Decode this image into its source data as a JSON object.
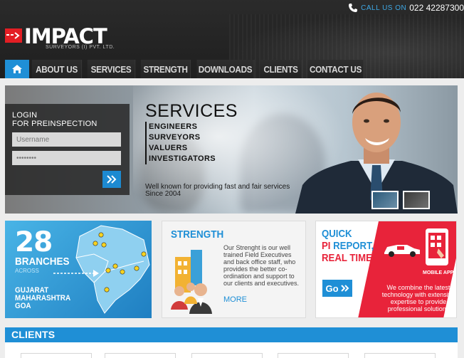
{
  "header": {
    "call_label": "CALL US ON",
    "phone": "022 42287300",
    "brand": "IMPACT",
    "brand_sub": "SURVEYORS (I) PVT. LTD."
  },
  "nav": {
    "home_icon": "home-icon",
    "items": [
      "ABOUT US",
      "SERVICES",
      "STRENGTH",
      "DOWNLOADS",
      "CLIENTS",
      "CONTACT US"
    ]
  },
  "login": {
    "title_line1": "LOGIN",
    "title_line2": "FOR PREINSPECTION",
    "username_placeholder": "Username",
    "password_value": "••••••••"
  },
  "services": {
    "title": "SERVICES",
    "items": [
      "ENGINEERS",
      "SURVEYORS",
      "VALUERS",
      "INVESTIGATORS"
    ],
    "tagline": "Well known for providing fast and fair services Since 2004"
  },
  "branches": {
    "count": "28",
    "label": "BRANCHES",
    "across": "ACROSS",
    "regions": [
      "GUJARAT",
      "MAHARASHTRA",
      "GOA"
    ]
  },
  "strength": {
    "title": "STRENGTH",
    "text": "Our Strenght is our well trained Field Executives and back office staff, who provides the better co-ordination and support to our clients and executives.",
    "more": "MORE"
  },
  "pi": {
    "line1": "QUICK",
    "line2_a": "PI ",
    "line2_b": "REPORT,",
    "line3": "REAL TIME!",
    "go": "Go",
    "app_label": "MOBILE APP",
    "desc": "We combine the latest technology with extensive expertise to provide professional solutions"
  },
  "clients": {
    "title": "CLIENTS"
  },
  "colors": {
    "accent_blue": "#1f8fd6",
    "brand_red": "#e31e24",
    "pi_red": "#e8233a",
    "header_dark": "#262626"
  }
}
